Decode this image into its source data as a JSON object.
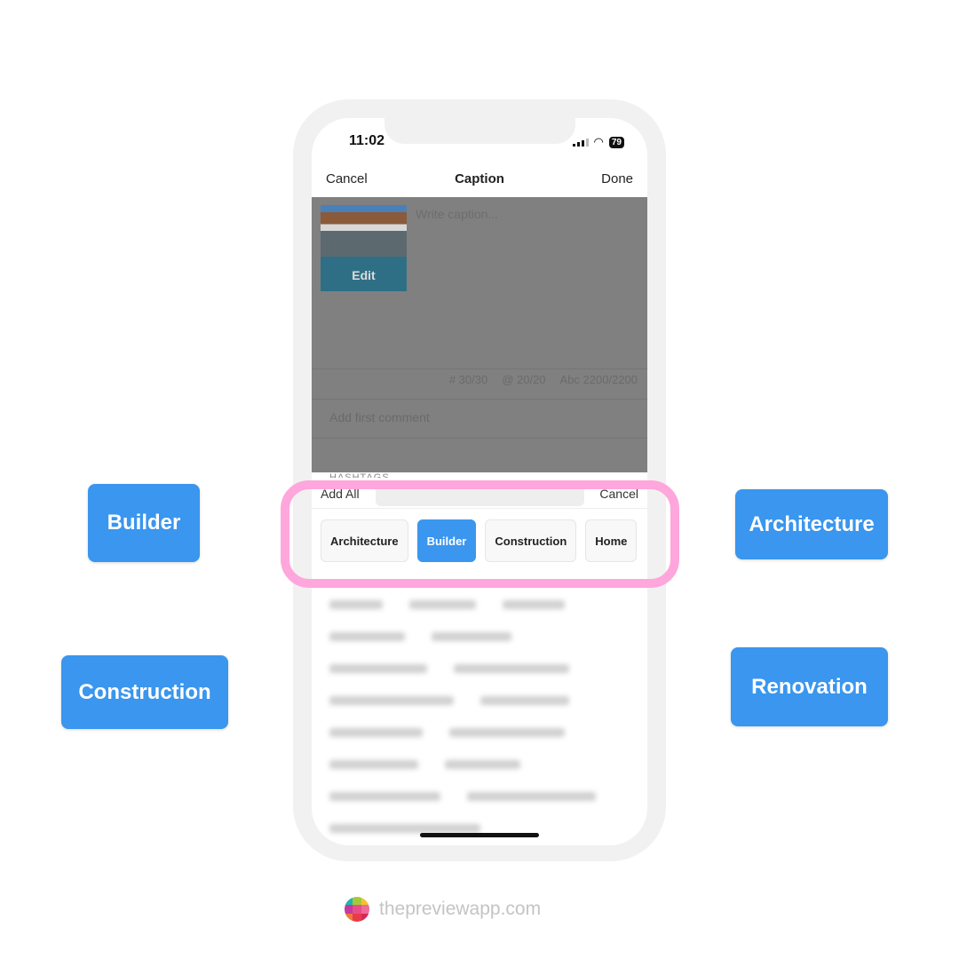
{
  "status": {
    "time": "11:02",
    "battery": "79"
  },
  "nav": {
    "cancel": "Cancel",
    "title": "Caption",
    "done": "Done"
  },
  "caption": {
    "placeholder": "Write caption...",
    "thumb_label": "Edit"
  },
  "counters": {
    "hashtags": "# 30/30",
    "mentions": "@ 20/20",
    "chars": "Abc 2200/2200"
  },
  "comment": {
    "placeholder": "Add first comment"
  },
  "hashtags": {
    "heading": "HASHTAGS",
    "add_all": "Add All",
    "cancel": "Cancel"
  },
  "chips": [
    {
      "label": "Architecture",
      "selected": false
    },
    {
      "label": "Builder",
      "selected": true
    },
    {
      "label": "Construction",
      "selected": false
    },
    {
      "label": "Home",
      "selected": false
    }
  ],
  "callouts": [
    "Builder",
    "Architecture",
    "Construction",
    "Renovation"
  ],
  "brand": {
    "text": "thepreviewapp.com",
    "logo_colors": [
      "#1fb5b0",
      "#a6c93a",
      "#f2c230",
      "#c43aa0",
      "#e84d8a",
      "#f06a9a",
      "#f07a3a",
      "#e83a4a",
      "#d42a5a"
    ]
  },
  "colors": {
    "accent": "#3a96ee",
    "highlight": "#ffa6dc"
  }
}
